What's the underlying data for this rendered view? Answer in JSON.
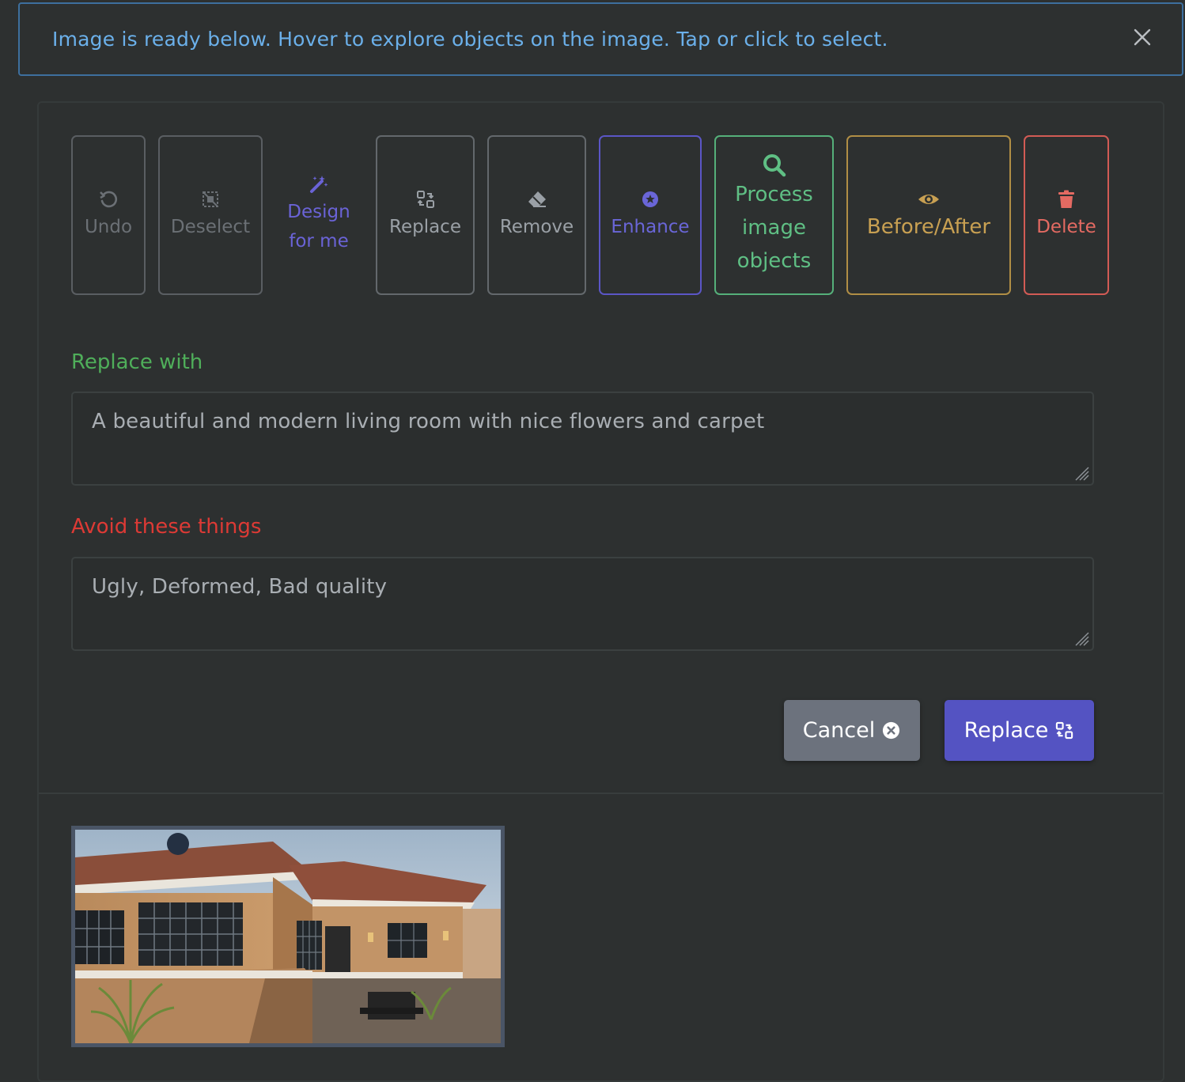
{
  "alert": {
    "message": "Image is ready below. Hover to explore objects on the image. Tap or click to select.",
    "color": "#6bb0ea"
  },
  "toolbar": {
    "undo": "Undo",
    "deselect": "Deselect",
    "design_line1": "Design",
    "design_line2": "for me",
    "replace": "Replace",
    "remove": "Remove",
    "enhance": "Enhance",
    "process_line1": "Process",
    "process_line2": "image",
    "process_line3": "objects",
    "before_after": "Before/After",
    "delete": "Delete"
  },
  "form": {
    "replace_label": "Replace with",
    "replace_value": "A beautiful and modern living room with nice flowers and carpet",
    "avoid_label": "Avoid these things",
    "avoid_value": "Ugly, Deformed, Bad quality"
  },
  "actions": {
    "cancel": "Cancel",
    "replace": "Replace"
  },
  "colors": {
    "accent": "#5453c2",
    "success": "#4fae5a",
    "danger": "#dd3a35",
    "warning": "#c8a052"
  },
  "icons": [
    "undo-icon",
    "deselect-icon",
    "magic-wand-icon",
    "replace-icon",
    "eraser-icon",
    "star-circle-icon",
    "search-icon",
    "eye-icon",
    "trash-icon",
    "close-circle-icon",
    "close-icon"
  ]
}
